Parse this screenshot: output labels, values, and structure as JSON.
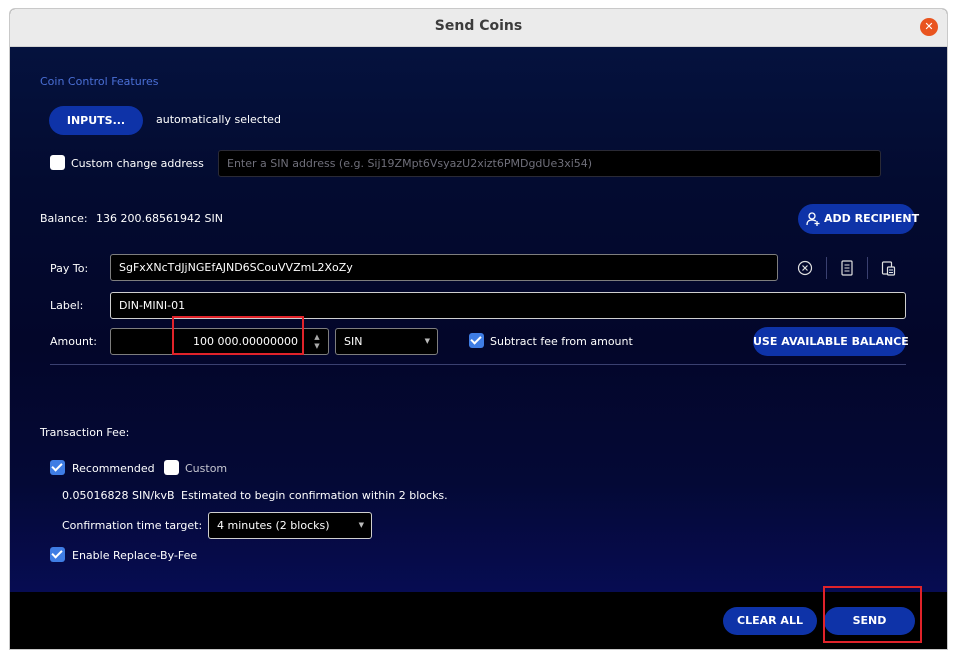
{
  "window": {
    "title": "Send Coins",
    "close_glyph": "✕"
  },
  "coin_control": {
    "title": "Coin Control Features",
    "inputs_button": "INPUTS...",
    "inputs_status": "automatically selected",
    "custom_change_label": "Custom change address",
    "custom_change_checked": false,
    "address_placeholder": "Enter a SIN address (e.g. Sij19ZMpt6VsyazU2xizt6PMDgdUe3xi54)"
  },
  "balance": {
    "label": "Balance:",
    "value": "136 200.68561942 SIN"
  },
  "add_recipient": {
    "label": "ADD RECIPIENT",
    "icon": "add-user-icon"
  },
  "recipient": {
    "pay_to_label": "Pay To:",
    "pay_to_value": "SgFxXNcTdJjNGEfAJND6SCouVVZmL2XoZy",
    "label_label": "Label:",
    "label_value": "DIN-MINI-01",
    "amount_label": "Amount:",
    "amount_value": "100 000.00000000",
    "unit": "SIN",
    "subtract_fee_label": "Subtract fee from amount",
    "subtract_fee_checked": true,
    "use_balance_label": "USE AVAILABLE BALANCE",
    "icons": [
      "clear-icon",
      "address-book-icon",
      "paste-icon"
    ]
  },
  "fee": {
    "title": "Transaction Fee:",
    "recommended_label": "Recommended",
    "recommended_checked": true,
    "custom_label": "Custom",
    "custom_checked": false,
    "rate": "0.05016828 SIN/kvB",
    "estimate": "Estimated to begin confirmation within 2 blocks.",
    "target_label": "Confirmation time target:",
    "target_value": "4 minutes (2 blocks)",
    "rbf_label": "Enable Replace-By-Fee",
    "rbf_checked": true
  },
  "footer": {
    "clear_all": "CLEAR ALL",
    "send": "SEND"
  },
  "colors": {
    "accent": "#0e33a8",
    "checkbox": "#3f7de4",
    "highlight": "#e0232a",
    "close": "#e9541f"
  }
}
